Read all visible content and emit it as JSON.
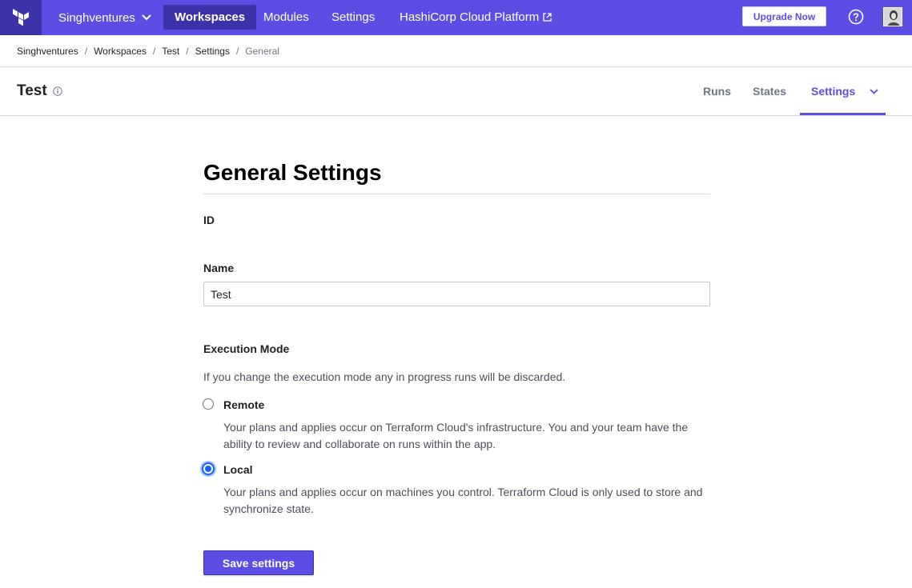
{
  "topnav": {
    "org": "Singhventures",
    "items": [
      "Workspaces",
      "Modules",
      "Settings",
      "HashiCorp Cloud Platform"
    ],
    "active_item": "Workspaces",
    "upgrade_label": "Upgrade Now",
    "icons": {
      "logo": "terraform-logo-icon",
      "org_caret": "chevron-down-icon",
      "external": "external-link-icon",
      "help": "help-circle-icon",
      "avatar": "user-avatar"
    }
  },
  "breadcrumb": [
    "Singhventures",
    "Workspaces",
    "Test",
    "Settings",
    "General"
  ],
  "workspace": {
    "title": "Test",
    "tabs": [
      "Runs",
      "States",
      "Settings"
    ],
    "active_tab": "Settings"
  },
  "form": {
    "title": "General Settings",
    "id_label": "ID",
    "name_label": "Name",
    "name_value": "Test",
    "execution_label": "Execution Mode",
    "execution_help": "If you change the execution mode any in progress runs will be discarded.",
    "options": [
      {
        "label": "Remote",
        "checked": false,
        "description": "Your plans and applies occur on Terraform Cloud's infrastructure. You and your team have the ability to review and collaborate on runs within the app."
      },
      {
        "label": "Local",
        "checked": true,
        "description": "Your plans and applies occur on machines you control. Terraform Cloud is only used to store and synchronize state."
      }
    ],
    "save_label": "Save settings"
  },
  "colors": {
    "brand": "#5c4ee5",
    "brand_dark": "#3d33a8",
    "radio_blue": "#1563ff"
  }
}
